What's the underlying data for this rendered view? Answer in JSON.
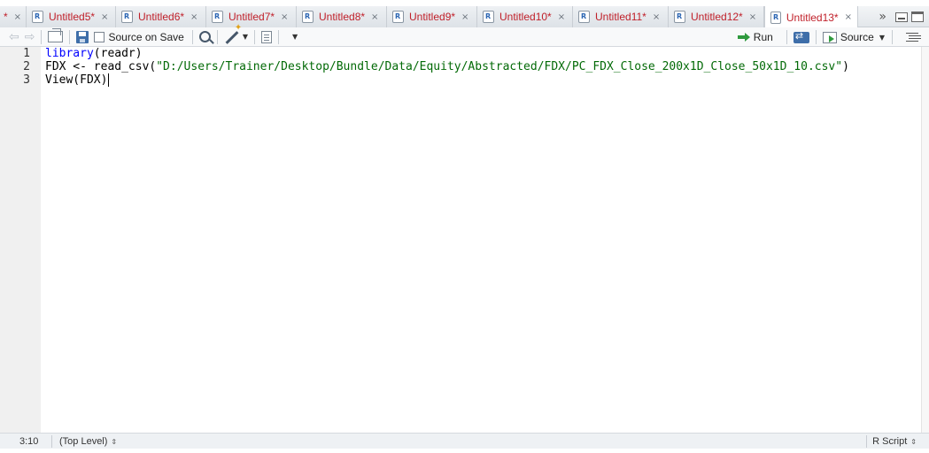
{
  "tabs": [
    {
      "label": "",
      "close": "×",
      "partial": true,
      "active": false
    },
    {
      "label": "Untitled5*",
      "close": "×",
      "active": false
    },
    {
      "label": "Untitled6*",
      "close": "×",
      "active": false
    },
    {
      "label": "Untitled7*",
      "close": "×",
      "active": false
    },
    {
      "label": "Untitled8*",
      "close": "×",
      "active": false
    },
    {
      "label": "Untitled9*",
      "close": "×",
      "active": false
    },
    {
      "label": "Untitled10*",
      "close": "×",
      "active": false
    },
    {
      "label": "Untitled11*",
      "close": "×",
      "active": false
    },
    {
      "label": "Untitled12*",
      "close": "×",
      "active": false
    },
    {
      "label": "Untitled13*",
      "close": "×",
      "active": true
    }
  ],
  "tab_overflow": "»",
  "toolbar": {
    "source_on_save_label": "Source on Save",
    "run_label": "Run",
    "source_label": "Source"
  },
  "editor": {
    "lines": [
      {
        "num": "1",
        "code": "library(readr)"
      },
      {
        "num": "2",
        "code": "FDX <- read_csv(\"D:/Users/Trainer/Desktop/Bundle/Data/Equity/Abstracted/FDX/PC_FDX_Close_200x1D_Close_50x1D_10.csv\")"
      },
      {
        "num": "3",
        "code": "View(FDX)"
      }
    ]
  },
  "status": {
    "position": "3:10",
    "scope": "(Top Level)",
    "file_type": "R Script"
  },
  "colors": {
    "tab_label": "#c0202a",
    "keyword": "#0000ff",
    "string": "#036a07",
    "run_green": "#2f9a3e"
  }
}
